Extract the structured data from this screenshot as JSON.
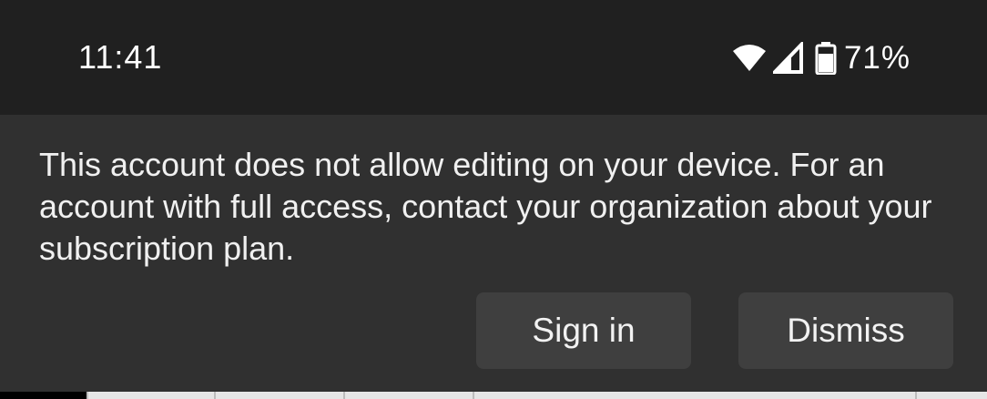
{
  "status_bar": {
    "time": "11:41",
    "battery_percent": "71%",
    "icons": [
      "wifi-icon",
      "cellular-signal-icon",
      "battery-icon"
    ]
  },
  "banner": {
    "message": "This account does not allow editing on your device. For an account with full access, contact your organization about your subscription plan.",
    "sign_in_label": "Sign in",
    "dismiss_label": "Dismiss"
  },
  "colors": {
    "status_bar_bg": "#202020",
    "banner_bg": "#303030",
    "button_bg": "#3f3f3f",
    "text": "#f0f0f0"
  }
}
